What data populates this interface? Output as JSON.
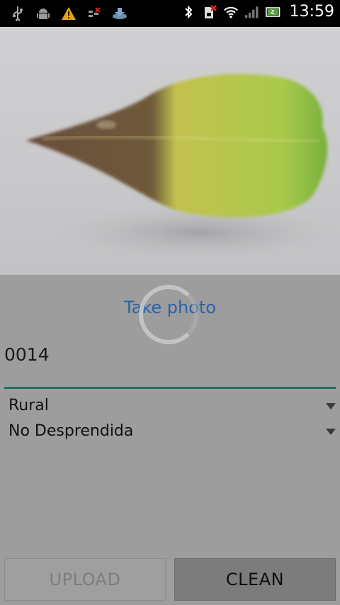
{
  "status_bar": {
    "time": "13:59",
    "icons_left": [
      "usb-icon",
      "android-debug-icon",
      "warning-icon",
      "no-sim-data-icon",
      "download-icon"
    ],
    "icons_right": [
      "bluetooth-icon",
      "no-sim-icon",
      "wifi-icon",
      "signal-icon",
      "battery-charging-icon"
    ]
  },
  "photo": {
    "subject": "leaf"
  },
  "take_photo_label": "Take photo",
  "id_field": {
    "value": "0014"
  },
  "spinners": [
    {
      "selected": "Rural"
    },
    {
      "selected": "No Desprendida"
    }
  ],
  "buttons": {
    "upload_label": "UPLOAD",
    "clean_label": "CLEAN"
  },
  "colors": {
    "accent_link": "#2b62a8",
    "field_underline": "#1f6f68",
    "background": "#9d9d9d"
  }
}
